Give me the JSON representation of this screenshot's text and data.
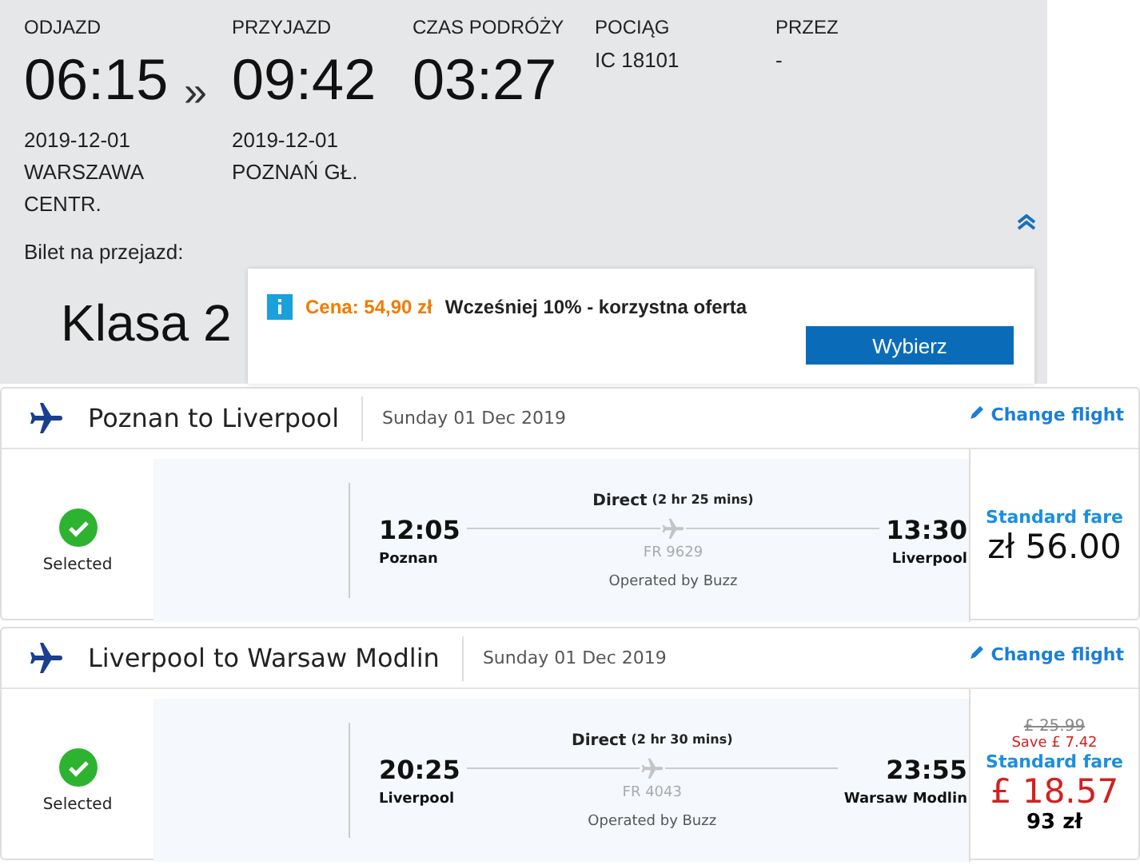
{
  "train": {
    "departure": {
      "label": "ODJAZD",
      "time": "06:15",
      "date": "2019-12-01",
      "station": "WARSZAWA CENTR."
    },
    "separator": "»",
    "arrival": {
      "label": "PRZYJAZD",
      "time": "09:42",
      "date": "2019-12-01",
      "station": "POZNAŃ GŁ."
    },
    "duration": {
      "label": "CZAS PODRÓŻY",
      "time": "03:27"
    },
    "train_no": {
      "label": "POCIĄG",
      "value": "IC 18101"
    },
    "via": {
      "label": "PRZEZ",
      "value": "-"
    },
    "ticket_label": "Bilet na przejazd:",
    "class": "Klasa 2",
    "offer": {
      "price": "Cena: 54,90 zł",
      "description": "Wcześniej 10% - korzystna oferta",
      "button": "Wybierz"
    }
  },
  "flights": [
    {
      "title": "Poznan to Liverpool",
      "date": "Sunday 01 Dec 2019",
      "change": "Change flight",
      "selected": true,
      "status": "Selected",
      "kind": "regular",
      "direct": "Direct",
      "duration": "(2 hr 25 mins)",
      "dep_time": "12:05",
      "dep_place": "Poznan",
      "arr_time": "13:30",
      "arr_place": "Liverpool",
      "flight_no": "FR 9629",
      "operator": "Operated by Buzz",
      "fare": "Standard fare",
      "price": "zł 56.00"
    },
    {
      "title": "Liverpool to Warsaw Modlin",
      "date": "Sunday 01 Dec 2019",
      "change": "Change flight",
      "selected": true,
      "status": "Selected",
      "kind": "discounted",
      "direct": "Direct",
      "duration": "(2 hr 30 mins)",
      "dep_time": "20:25",
      "dep_place": "Liverpool",
      "arr_time": "23:55",
      "arr_place": "Warsaw Modlin",
      "flight_no": "FR 4043",
      "operator": "Operated by Buzz",
      "old_price": "£ 25.99",
      "save": "Save £ 7.42",
      "fare": "Standard fare",
      "price": "£ 18.57",
      "local_price": "93 zł"
    }
  ]
}
